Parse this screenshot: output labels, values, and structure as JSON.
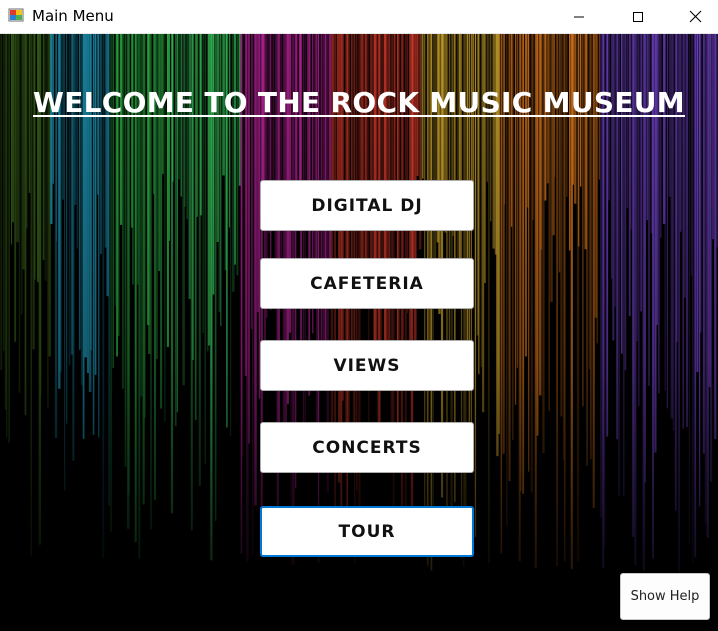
{
  "window": {
    "title": "Main Menu",
    "app_icon": "winforms-app-icon",
    "controls": [
      "minimize-icon",
      "maximize-icon",
      "close-icon"
    ]
  },
  "main": {
    "heading": "WELCOME TO THE ROCK MUSIC MUSEUM",
    "buttons": [
      {
        "label": "DIGITAL DJ"
      },
      {
        "label": "CAFETERIA"
      },
      {
        "label": "VIEWS"
      },
      {
        "label": "CONCERTS"
      },
      {
        "label": "TOUR",
        "focused": true
      }
    ],
    "help_button": "Show Help"
  },
  "background": {
    "description_colors": [
      "#2f7a1c",
      "#1aa3c4",
      "#2fd45a",
      "#c51fa3",
      "#e0342a",
      "#f2c230",
      "#e87a1a",
      "#8a4ee0"
    ]
  }
}
